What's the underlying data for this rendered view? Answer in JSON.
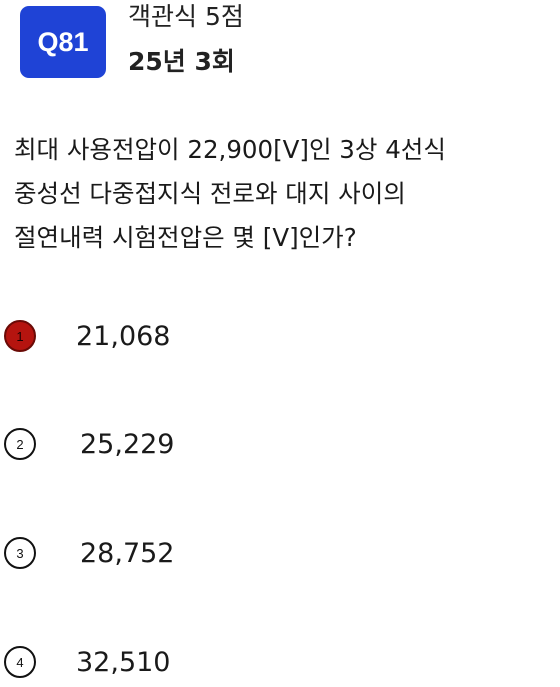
{
  "header": {
    "badge": "Q81",
    "type_label": "객관식 5점",
    "round_label": "25년 3회"
  },
  "question": {
    "lines": [
      "최대 사용전압이 22,900[V]인 3상 4선식",
      "중성선 다중접지식 전로와 대지 사이의",
      "절연내력 시험전압은 몇 [V]인가?"
    ]
  },
  "choices": [
    {
      "number": "1",
      "text": "21,068",
      "selected": true
    },
    {
      "number": "2",
      "text": "25,229",
      "selected": false
    },
    {
      "number": "3",
      "text": "28,752",
      "selected": false
    },
    {
      "number": "4",
      "text": "32,510",
      "selected": false
    }
  ],
  "colors": {
    "badge_bg": "#1f43d6",
    "selected_marker": "#b5140f"
  }
}
